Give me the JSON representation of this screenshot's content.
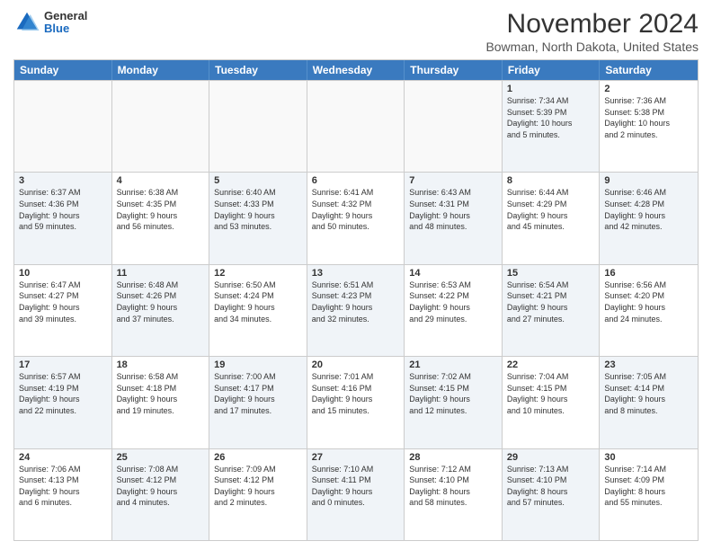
{
  "header": {
    "logo_general": "General",
    "logo_blue": "Blue",
    "month_title": "November 2024",
    "subtitle": "Bowman, North Dakota, United States"
  },
  "days_of_week": [
    "Sunday",
    "Monday",
    "Tuesday",
    "Wednesday",
    "Thursday",
    "Friday",
    "Saturday"
  ],
  "rows": [
    [
      {
        "num": "",
        "detail": "",
        "empty": true
      },
      {
        "num": "",
        "detail": "",
        "empty": true
      },
      {
        "num": "",
        "detail": "",
        "empty": true
      },
      {
        "num": "",
        "detail": "",
        "empty": true
      },
      {
        "num": "",
        "detail": "",
        "empty": true
      },
      {
        "num": "1",
        "detail": "Sunrise: 7:34 AM\nSunset: 5:39 PM\nDaylight: 10 hours\nand 5 minutes.",
        "shaded": true
      },
      {
        "num": "2",
        "detail": "Sunrise: 7:36 AM\nSunset: 5:38 PM\nDaylight: 10 hours\nand 2 minutes.",
        "shaded": false
      }
    ],
    [
      {
        "num": "3",
        "detail": "Sunrise: 6:37 AM\nSunset: 4:36 PM\nDaylight: 9 hours\nand 59 minutes.",
        "shaded": true
      },
      {
        "num": "4",
        "detail": "Sunrise: 6:38 AM\nSunset: 4:35 PM\nDaylight: 9 hours\nand 56 minutes.",
        "shaded": false
      },
      {
        "num": "5",
        "detail": "Sunrise: 6:40 AM\nSunset: 4:33 PM\nDaylight: 9 hours\nand 53 minutes.",
        "shaded": true
      },
      {
        "num": "6",
        "detail": "Sunrise: 6:41 AM\nSunset: 4:32 PM\nDaylight: 9 hours\nand 50 minutes.",
        "shaded": false
      },
      {
        "num": "7",
        "detail": "Sunrise: 6:43 AM\nSunset: 4:31 PM\nDaylight: 9 hours\nand 48 minutes.",
        "shaded": true
      },
      {
        "num": "8",
        "detail": "Sunrise: 6:44 AM\nSunset: 4:29 PM\nDaylight: 9 hours\nand 45 minutes.",
        "shaded": false
      },
      {
        "num": "9",
        "detail": "Sunrise: 6:46 AM\nSunset: 4:28 PM\nDaylight: 9 hours\nand 42 minutes.",
        "shaded": true
      }
    ],
    [
      {
        "num": "10",
        "detail": "Sunrise: 6:47 AM\nSunset: 4:27 PM\nDaylight: 9 hours\nand 39 minutes.",
        "shaded": false
      },
      {
        "num": "11",
        "detail": "Sunrise: 6:48 AM\nSunset: 4:26 PM\nDaylight: 9 hours\nand 37 minutes.",
        "shaded": true
      },
      {
        "num": "12",
        "detail": "Sunrise: 6:50 AM\nSunset: 4:24 PM\nDaylight: 9 hours\nand 34 minutes.",
        "shaded": false
      },
      {
        "num": "13",
        "detail": "Sunrise: 6:51 AM\nSunset: 4:23 PM\nDaylight: 9 hours\nand 32 minutes.",
        "shaded": true
      },
      {
        "num": "14",
        "detail": "Sunrise: 6:53 AM\nSunset: 4:22 PM\nDaylight: 9 hours\nand 29 minutes.",
        "shaded": false
      },
      {
        "num": "15",
        "detail": "Sunrise: 6:54 AM\nSunset: 4:21 PM\nDaylight: 9 hours\nand 27 minutes.",
        "shaded": true
      },
      {
        "num": "16",
        "detail": "Sunrise: 6:56 AM\nSunset: 4:20 PM\nDaylight: 9 hours\nand 24 minutes.",
        "shaded": false
      }
    ],
    [
      {
        "num": "17",
        "detail": "Sunrise: 6:57 AM\nSunset: 4:19 PM\nDaylight: 9 hours\nand 22 minutes.",
        "shaded": true
      },
      {
        "num": "18",
        "detail": "Sunrise: 6:58 AM\nSunset: 4:18 PM\nDaylight: 9 hours\nand 19 minutes.",
        "shaded": false
      },
      {
        "num": "19",
        "detail": "Sunrise: 7:00 AM\nSunset: 4:17 PM\nDaylight: 9 hours\nand 17 minutes.",
        "shaded": true
      },
      {
        "num": "20",
        "detail": "Sunrise: 7:01 AM\nSunset: 4:16 PM\nDaylight: 9 hours\nand 15 minutes.",
        "shaded": false
      },
      {
        "num": "21",
        "detail": "Sunrise: 7:02 AM\nSunset: 4:15 PM\nDaylight: 9 hours\nand 12 minutes.",
        "shaded": true
      },
      {
        "num": "22",
        "detail": "Sunrise: 7:04 AM\nSunset: 4:15 PM\nDaylight: 9 hours\nand 10 minutes.",
        "shaded": false
      },
      {
        "num": "23",
        "detail": "Sunrise: 7:05 AM\nSunset: 4:14 PM\nDaylight: 9 hours\nand 8 minutes.",
        "shaded": true
      }
    ],
    [
      {
        "num": "24",
        "detail": "Sunrise: 7:06 AM\nSunset: 4:13 PM\nDaylight: 9 hours\nand 6 minutes.",
        "shaded": false
      },
      {
        "num": "25",
        "detail": "Sunrise: 7:08 AM\nSunset: 4:12 PM\nDaylight: 9 hours\nand 4 minutes.",
        "shaded": true
      },
      {
        "num": "26",
        "detail": "Sunrise: 7:09 AM\nSunset: 4:12 PM\nDaylight: 9 hours\nand 2 minutes.",
        "shaded": false
      },
      {
        "num": "27",
        "detail": "Sunrise: 7:10 AM\nSunset: 4:11 PM\nDaylight: 9 hours\nand 0 minutes.",
        "shaded": true
      },
      {
        "num": "28",
        "detail": "Sunrise: 7:12 AM\nSunset: 4:10 PM\nDaylight: 8 hours\nand 58 minutes.",
        "shaded": false
      },
      {
        "num": "29",
        "detail": "Sunrise: 7:13 AM\nSunset: 4:10 PM\nDaylight: 8 hours\nand 57 minutes.",
        "shaded": true
      },
      {
        "num": "30",
        "detail": "Sunrise: 7:14 AM\nSunset: 4:09 PM\nDaylight: 8 hours\nand 55 minutes.",
        "shaded": false
      }
    ]
  ]
}
